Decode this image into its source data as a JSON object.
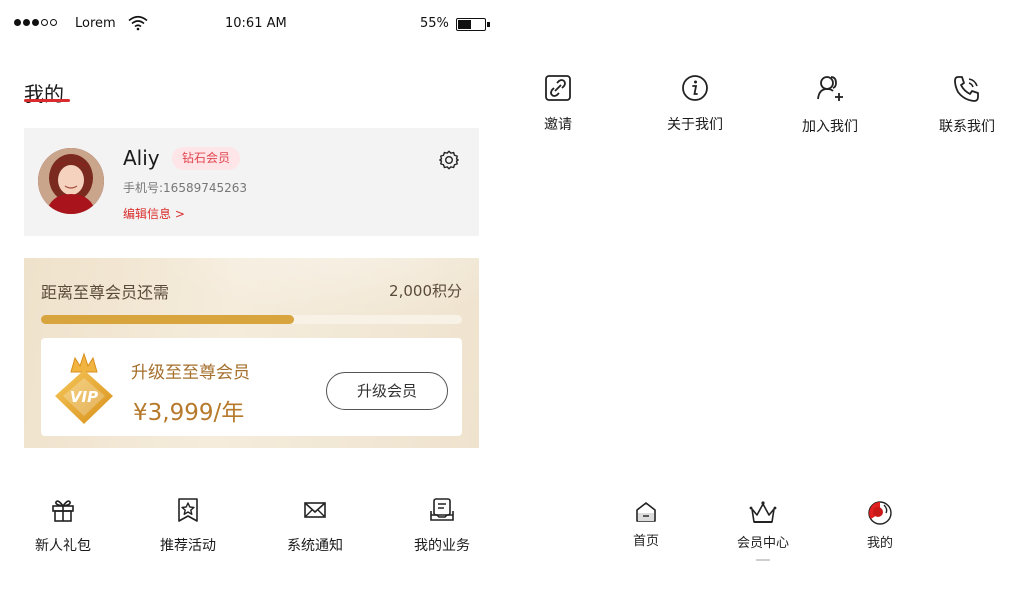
{
  "status_bar": {
    "carrier": "Lorem",
    "time": "10:61 AM",
    "battery": "55%",
    "battery_level": 0.55,
    "signal_bars": 3,
    "signal_total": 5
  },
  "page": {
    "title": "我的"
  },
  "profile": {
    "name": "Aliy",
    "badge": "钻石会员",
    "phone": "手机号:16589745263",
    "edit_link": "编辑信息 >",
    "icons": {
      "avatar": "avatar",
      "settings": "gear-icon"
    }
  },
  "vip": {
    "distance_label": "距离至尊会员还需",
    "points": "2,000积分",
    "progress": 0.6,
    "upgrade_title": "升级至至尊会员",
    "price": "¥3,999/年",
    "upgrade_button": "升级会员",
    "emblem_text": "VIP"
  },
  "quick_actions": [
    {
      "label": "新人礼包",
      "icon": "gift-icon"
    },
    {
      "label": "推荐活动",
      "icon": "star-badge-icon"
    },
    {
      "label": "系统通知",
      "icon": "mail-icon"
    },
    {
      "label": "我的业务",
      "icon": "clipboard-icon"
    }
  ],
  "top_actions": [
    {
      "label": "邀请",
      "icon": "link-icon"
    },
    {
      "label": "关于我们",
      "icon": "info-icon"
    },
    {
      "label": "加入我们",
      "icon": "add-user-icon"
    },
    {
      "label": "联系我们",
      "icon": "phone-call-icon"
    }
  ],
  "bottom_nav": [
    {
      "label": "首页",
      "icon": "home-icon"
    },
    {
      "label": "会员中心",
      "icon": "crown-icon"
    },
    {
      "label": "我的",
      "icon": "profile-icon"
    }
  ],
  "colors": {
    "accent": "#d92d2d",
    "gold": "#d8a43e",
    "badge_bg": "#fde5e8"
  }
}
